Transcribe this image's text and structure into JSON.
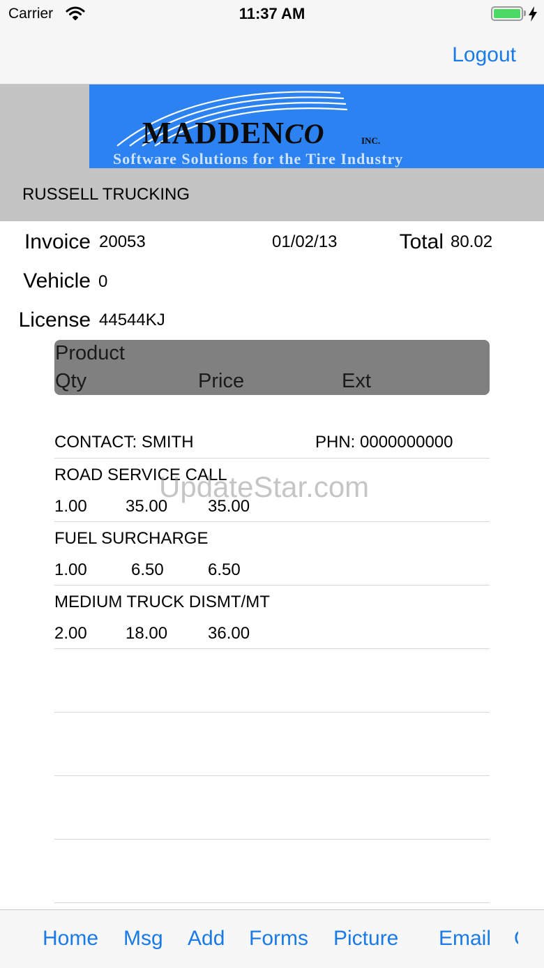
{
  "status_bar": {
    "carrier": "Carrier",
    "time": "11:37 AM"
  },
  "nav": {
    "logout_label": "Logout"
  },
  "banner": {
    "logo_word": "MADDEN",
    "logo_co": "CO",
    "logo_inc": "INC.",
    "tagline": "Software Solutions for the Tire Industry",
    "brand_color": "#2b82f0"
  },
  "customer": {
    "name": "RUSSELL TRUCKING"
  },
  "invoice": {
    "invoice_label": "Invoice",
    "invoice_number": "20053",
    "date": "01/02/13",
    "total_label": "Total",
    "total_value": "80.02",
    "vehicle_label": "Vehicle",
    "vehicle_value": "0",
    "license_label": "License",
    "license_value": "44544KJ"
  },
  "columns": {
    "product": "Product",
    "qty": "Qty",
    "price": "Price",
    "ext": "Ext"
  },
  "contact": {
    "name": "CONTACT: SMITH",
    "phone": "PHN: 0000000000"
  },
  "items": [
    {
      "product": "ROAD SERVICE CALL",
      "qty": "1.00",
      "price": "35.00",
      "ext": "35.00"
    },
    {
      "product": "FUEL SURCHARGE",
      "qty": "1.00",
      "price": "6.50",
      "ext": "6.50"
    },
    {
      "product": "MEDIUM TRUCK DISMT/MT",
      "qty": "2.00",
      "price": "18.00",
      "ext": "36.00"
    }
  ],
  "watermark": "UpdateStar.com",
  "tabs": [
    "Home",
    "Msg",
    "Add",
    "Forms",
    "Picture",
    "Email"
  ],
  "accent_color": "#1a7ae6"
}
